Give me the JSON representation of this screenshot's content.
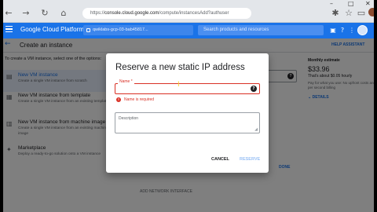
{
  "browser": {
    "url_prefix": "https://",
    "url_host": "console.cloud.google.com",
    "url_path": "/compute/instancesAdd?authuser"
  },
  "header": {
    "app_title": "Google Cloud Platform",
    "project": "qwiklabs-gcp-03-bab45817...",
    "search_placeholder": "Search products and resources"
  },
  "page": {
    "title": "Create an instance",
    "help_link": "HELP ASSISTANT",
    "intro": "To create a VM instance, select one of the options:",
    "options": [
      {
        "title": "New VM instance",
        "desc": "Create a single VM instance from scratch"
      },
      {
        "title": "New VM instance from template",
        "desc": "Create a single VM instance from an existing template"
      },
      {
        "title": "New VM instance from machine image",
        "desc": "Create a single VM instance from an existing machine image"
      },
      {
        "title": "Marketplace",
        "desc": "Deploy a ready-to-go solution onto a VM instance"
      }
    ],
    "estimate": {
      "label": "Monthly estimate",
      "price": "$33.96",
      "hourly": "That's about $0.05 hourly",
      "note": "Pay for what you use: No upfront costs and per second billing",
      "details": "DETAILS"
    },
    "done": "DONE",
    "add_interface": "ADD NETWORK INTERFACE"
  },
  "dialog": {
    "title": "Reserve a new static IP address",
    "name_label": "Name",
    "name_required_mark": "*",
    "error": "Name is required",
    "description_label": "Description",
    "cancel": "CANCEL",
    "reserve": "RESERVE"
  }
}
